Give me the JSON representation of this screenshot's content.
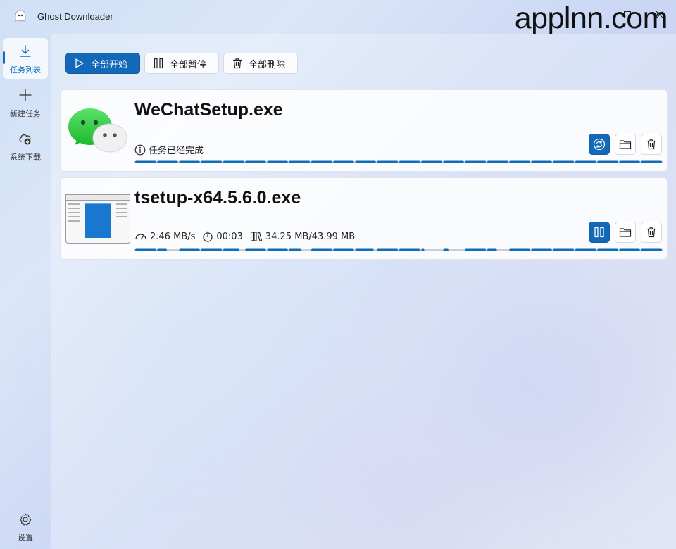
{
  "window": {
    "title": "Ghost Downloader",
    "watermark": "applnn.com"
  },
  "sidebar": {
    "items": [
      {
        "label": "任务列表",
        "icon": "download-icon",
        "active": true
      },
      {
        "label": "新建任务",
        "icon": "plus-icon",
        "active": false
      },
      {
        "label": "系统下载",
        "icon": "cloud-download-icon",
        "active": false
      }
    ],
    "settings_label": "设置"
  },
  "toolbar": {
    "start_all": "全部开始",
    "pause_all": "全部暂停",
    "delete_all": "全部删除"
  },
  "tasks": [
    {
      "file_name": "WeChatSetup.exe",
      "status": "任务已经完成",
      "progress": 1.0,
      "primary_action_icon": "refresh-icon"
    },
    {
      "file_name": "tsetup-x64.5.6.0.exe",
      "speed": "2.46 MB/s",
      "time_left": "00:03",
      "size": "34.25 MB/43.99 MB",
      "progress": 0.779,
      "primary_action_icon": "pause-icon"
    }
  ],
  "colors": {
    "accent": "#1368b8",
    "progress": "#0f6cb7"
  }
}
